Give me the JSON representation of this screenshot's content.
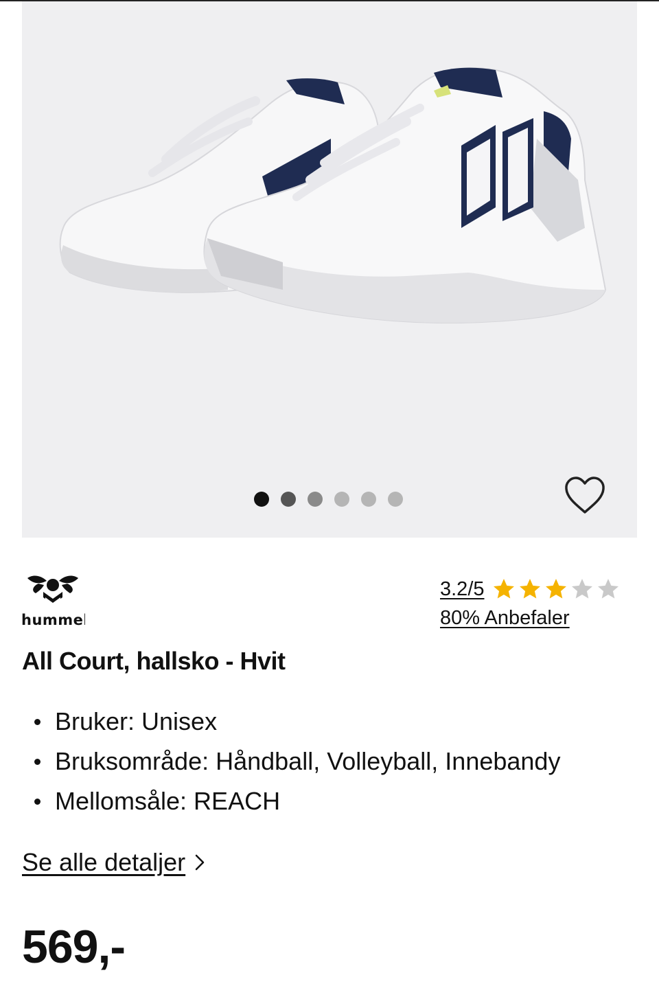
{
  "gallery": {
    "image_alt": "hummel All Court hallsko i hvit med marineblå detaljer",
    "dots_total": 6,
    "dots_active_index": 0,
    "favorite_icon": "heart-outline-icon"
  },
  "brand": {
    "name": "hummel"
  },
  "rating": {
    "score_text": "3.2/5",
    "score": 3.2,
    "max": 5,
    "stars_filled": 3,
    "recommend_text": "80% Anbefaler",
    "star_color": "#f5b301",
    "star_empty_color": "#c9c9c9"
  },
  "product": {
    "title": "All Court, hallsko - Hvit",
    "features": [
      "Bruker: Unisex",
      "Bruksområde: Håndball, Volleyball, Innebandy",
      "Mellomsåle: REACH"
    ]
  },
  "details_link": {
    "label": "Se alle detaljer",
    "icon": "chevron-right-icon"
  },
  "price": {
    "text": "569,-"
  }
}
